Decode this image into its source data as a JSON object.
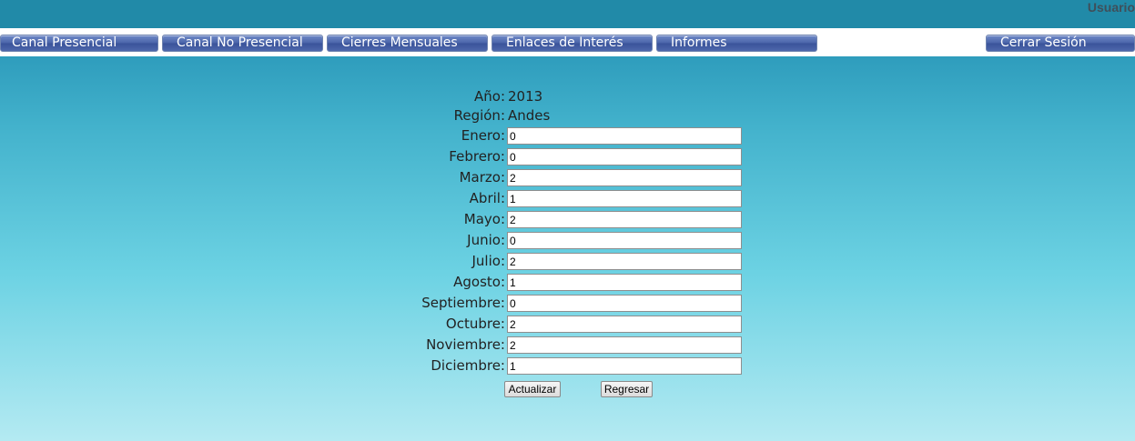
{
  "header": {
    "user_label": "Usuario"
  },
  "menu": {
    "items": [
      {
        "label": "Canal Presencial"
      },
      {
        "label": "Canal No Presencial"
      },
      {
        "label": "Cierres Mensuales"
      },
      {
        "label": "Enlaces de Interés"
      },
      {
        "label": "Informes"
      }
    ],
    "logout_label": "Cerrar Sesión"
  },
  "form": {
    "year_label": "Año:",
    "year_value": "2013",
    "region_label": "Región:",
    "region_value": "Andes",
    "months": [
      {
        "label": "Enero:",
        "value": "0"
      },
      {
        "label": "Febrero:",
        "value": "0"
      },
      {
        "label": "Marzo:",
        "value": "2"
      },
      {
        "label": "Abril:",
        "value": "1"
      },
      {
        "label": "Mayo:",
        "value": "2"
      },
      {
        "label": "Junio:",
        "value": "0"
      },
      {
        "label": "Julio:",
        "value": "2"
      },
      {
        "label": "Agosto:",
        "value": "1"
      },
      {
        "label": "Septiembre:",
        "value": "0"
      },
      {
        "label": "Octubre:",
        "value": "2"
      },
      {
        "label": "Noviembre:",
        "value": "2"
      },
      {
        "label": "Diciembre:",
        "value": "1"
      }
    ],
    "update_label": "Actualizar",
    "back_label": "Regresar"
  }
}
